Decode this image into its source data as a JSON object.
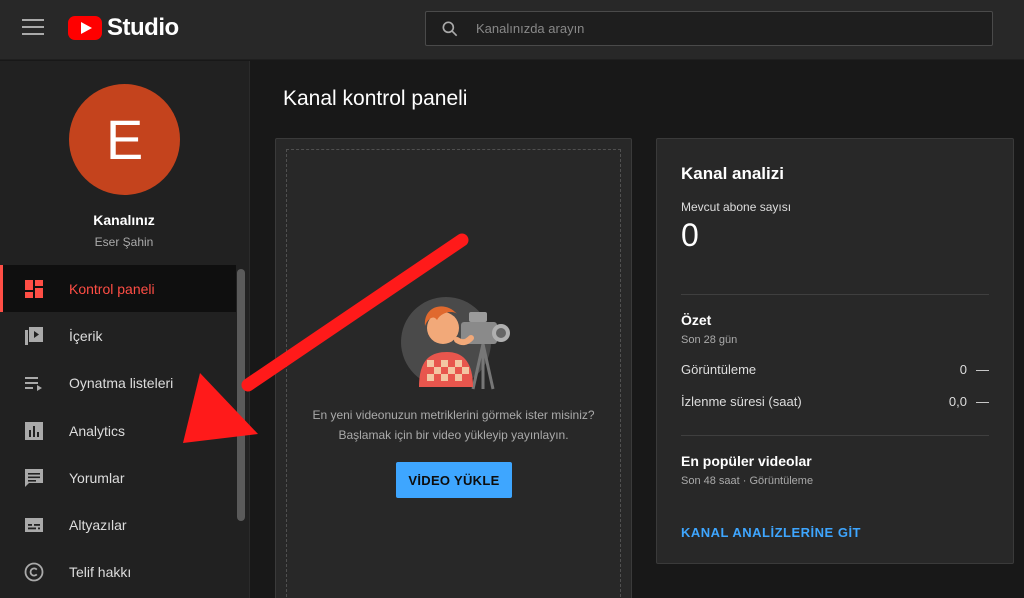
{
  "header": {
    "logo_text": "Studio",
    "search_placeholder": "Kanalınızda arayın"
  },
  "sidebar": {
    "avatar_letter": "E",
    "channel_name": "Kanalınız",
    "channel_owner": "Eser Şahin",
    "items": [
      {
        "label": "Kontrol paneli",
        "icon": "dashboard-icon",
        "active": true
      },
      {
        "label": "İçerik",
        "icon": "content-icon",
        "active": false
      },
      {
        "label": "Oynatma listeleri",
        "icon": "playlist-icon",
        "active": false
      },
      {
        "label": "Analytics",
        "icon": "analytics-icon",
        "active": false
      },
      {
        "label": "Yorumlar",
        "icon": "comments-icon",
        "active": false
      },
      {
        "label": "Altyazılar",
        "icon": "subtitles-icon",
        "active": false
      },
      {
        "label": "Telif hakkı",
        "icon": "copyright-icon",
        "active": false
      }
    ]
  },
  "main": {
    "page_title": "Kanal kontrol paneli",
    "upload_card": {
      "text_line1": "En yeni videonuzun metriklerini görmek ister misiniz?",
      "text_line2": "Başlamak için bir video yükleyip yayınlayın.",
      "button_label": "VİDEO YÜKLE"
    },
    "analytics_card": {
      "title": "Kanal analizi",
      "subscribers_label": "Mevcut abone sayısı",
      "subscribers_count": "0",
      "summary_title": "Özet",
      "summary_period": "Son 28 gün",
      "rows": [
        {
          "label": "Görüntüleme",
          "value": "0",
          "trend": "—"
        },
        {
          "label": "İzlenme süresi (saat)",
          "value": "0,0",
          "trend": "—"
        }
      ],
      "top_videos_title": "En popüler videolar",
      "top_videos_meta": "Son 48 saat · Görüntüleme",
      "link_label": "KANAL ANALİZLERİNE GİT"
    }
  },
  "colors": {
    "accent_red": "#ff4e45",
    "link_blue": "#3ea6ff",
    "avatar": "#c4431d",
    "annotation_arrow": "#ff1a1a"
  }
}
